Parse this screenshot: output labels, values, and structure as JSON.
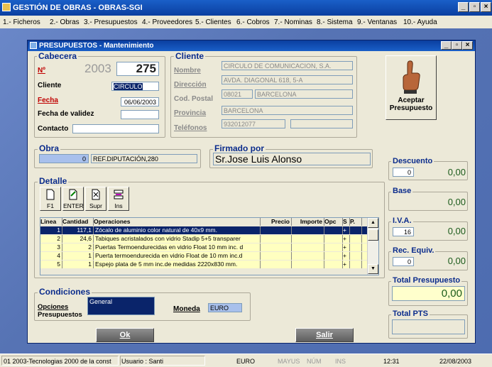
{
  "app": {
    "title": "GESTIÓN DE OBRAS - OBRAS-SGI"
  },
  "menu": [
    "1.- Ficheros",
    "2.- Obras",
    "3.- Presupuestos",
    "4.- Proveedores",
    "5.- Clientes",
    "6.- Cobros",
    "7.- Nominas",
    "8.- Sistema",
    "9.- Ventanas",
    "10.- Ayuda"
  ],
  "window": {
    "title": "PRESUPUESTOS - Mantenimiento"
  },
  "cabecera": {
    "group_label": "Cabecera",
    "n_label": "Nº",
    "year": "2003",
    "number": "275",
    "cliente_label": "Cliente",
    "cliente_value": "CIRCULO",
    "fecha_label": "Fecha",
    "fecha_value": "06/06/2003",
    "validez_label": "Fecha de validez",
    "validez_value": "",
    "contacto_label": "Contacto",
    "contacto_value": ""
  },
  "cliente": {
    "group_label": "Cliente",
    "nombre_label": "Nombre",
    "nombre_value": "CIRCULO DE COMUNICACION, S.A.",
    "direccion_label": "Dirección",
    "direccion_value": "AVDA. DIAGONAL 618, 5-A",
    "cp_label": "Cod. Postal",
    "cp_value": "08021",
    "ciudad_value": "BARCELONA",
    "provincia_label": "Provincia",
    "provincia_value": "BARCELONA",
    "telefonos_label": "Teléfonos",
    "telefono1": "932012077",
    "telefono2": ""
  },
  "aceptar": {
    "label_line1": "Aceptar",
    "label_line2": "Presupuesto"
  },
  "obra": {
    "group_label": "Obra",
    "code": "0",
    "name": "REF.DIPUTACIÓN,280"
  },
  "firmado": {
    "group_label": "Firmado por",
    "value": "Sr.Jose Luis Alonso"
  },
  "detalle": {
    "group_label": "Detalle",
    "toolbar": [
      {
        "label": "F1",
        "icon": "new-doc-icon"
      },
      {
        "label": "ENTER",
        "icon": "edit-doc-icon"
      },
      {
        "label": "Supr",
        "icon": "delete-doc-icon"
      },
      {
        "label": "Ins",
        "icon": "insert-icon"
      }
    ],
    "columns": [
      "Linea",
      "Cantidad",
      "Operaciones",
      "Precio",
      "Importe",
      "Opc",
      "S",
      "P."
    ],
    "rows": [
      {
        "linea": "1",
        "cantidad": "117,1",
        "op": "Zócalo de aluminio color natural de 40x9 mm.",
        "s": "+"
      },
      {
        "linea": "2",
        "cantidad": "24,6",
        "op": "Tabiques acristalados con vidrio Stadip 5+5 transparer",
        "s": "+"
      },
      {
        "linea": "3",
        "cantidad": "2",
        "op": "Puertas Termoendurecidas en vidrio Float 10 mm inc. d",
        "s": "+"
      },
      {
        "linea": "4",
        "cantidad": "1",
        "op": "Puerta termoendurecida en vidrio Float de 10 mm inc.d",
        "s": "+"
      },
      {
        "linea": "5",
        "cantidad": "1",
        "op": "Espejo plata de 5 mm inc.de medidas 2220x830 mm.",
        "s": "+"
      }
    ]
  },
  "condiciones": {
    "group_label": "Condiciones",
    "opciones_label": "Opciones",
    "presupuestos_label": "Presupuestos",
    "opciones_value": "General",
    "moneda_label": "Moneda",
    "moneda_value": "EURO"
  },
  "totals": {
    "descuento_label": "Descuento",
    "descuento_pct": "0",
    "descuento_value": "0,00",
    "base_label": "Base",
    "base_value": "0,00",
    "iva_label": "I.V.A.",
    "iva_pct": "16",
    "iva_value": "0,00",
    "rec_label": "Rec. Equiv.",
    "rec_pct": "0",
    "rec_value": "0,00",
    "total_label": "Total Presupuesto",
    "total_value": "0,00",
    "pts_label": "Total PTS",
    "pts_value": ""
  },
  "buttons": {
    "ok": "Ok",
    "salir": "Salir"
  },
  "statusbar": {
    "company": "01  2003-Tecnologias 2000 de la const",
    "user": "Usuario : Santi",
    "currency": "EURO",
    "mayus": "MAYUS",
    "num": "NÚM",
    "ins": "INS",
    "time": "12:31",
    "date": "22/08/2003"
  },
  "colors": {
    "accent_title": "#0b2c8c",
    "selection": "#0a246a",
    "row_highlight": "#ffffc0",
    "total_bg": "#ffffcc"
  }
}
